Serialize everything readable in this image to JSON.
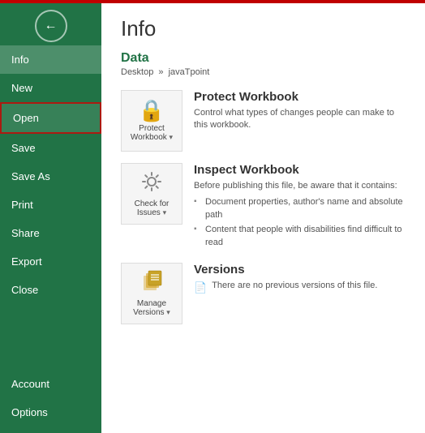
{
  "topbar": {
    "accent_color": "#c00000",
    "green_color": "#217346"
  },
  "sidebar": {
    "back_icon": "←",
    "items": [
      {
        "id": "info",
        "label": "Info",
        "active": true
      },
      {
        "id": "new",
        "label": "New",
        "active": false
      },
      {
        "id": "open",
        "label": "Open",
        "active": false,
        "highlighted": true
      },
      {
        "id": "save",
        "label": "Save",
        "active": false
      },
      {
        "id": "save-as",
        "label": "Save As",
        "active": false
      },
      {
        "id": "print",
        "label": "Print",
        "active": false
      },
      {
        "id": "share",
        "label": "Share",
        "active": false
      },
      {
        "id": "export",
        "label": "Export",
        "active": false
      },
      {
        "id": "close",
        "label": "Close",
        "active": false
      }
    ],
    "bottom_items": [
      {
        "id": "account",
        "label": "Account"
      },
      {
        "id": "options",
        "label": "Options"
      }
    ]
  },
  "main": {
    "title": "Info",
    "file_section": {
      "name": "Data",
      "path_parts": [
        "Desktop",
        "javaTpoint"
      ]
    },
    "cards": [
      {
        "id": "protect-workbook",
        "icon_label": "Protect\nWorkbook",
        "icon_symbol": "🔒",
        "title": "Protect Workbook",
        "description": "Control what types of changes people can make to this workbook.",
        "has_dropdown": true,
        "list_items": []
      },
      {
        "id": "inspect-workbook",
        "icon_label": "Check for\nIssues",
        "icon_symbol": "⚙",
        "title": "Inspect Workbook",
        "description": "Before publishing this file, be aware that it contains:",
        "has_dropdown": true,
        "list_items": [
          "Document properties, author's name and absolute path",
          "Content that people with disabilities find difficult to read"
        ]
      },
      {
        "id": "versions",
        "icon_label": "Manage\nVersions",
        "icon_symbol": "📄",
        "title": "Versions",
        "description": "There are no previous versions of this file.",
        "has_dropdown": true,
        "list_items": []
      }
    ]
  }
}
